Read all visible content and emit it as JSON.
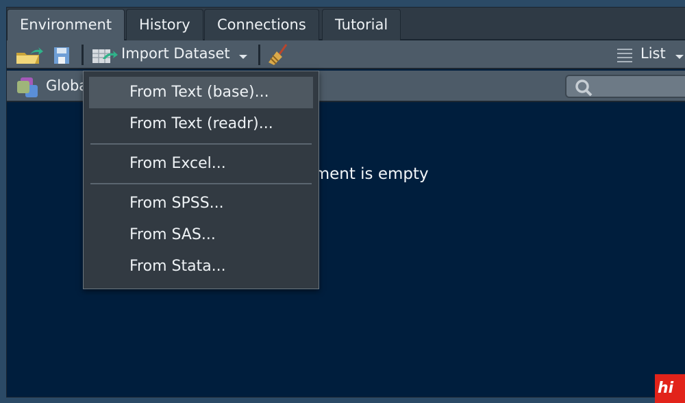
{
  "tabs": [
    {
      "label": "Environment",
      "active": true
    },
    {
      "label": "History"
    },
    {
      "label": "Connections"
    },
    {
      "label": "Tutorial"
    }
  ],
  "toolbar": {
    "import_label": "Import Dataset",
    "view_label": "List"
  },
  "environment_selector": "Global Environment",
  "search": {
    "placeholder": ""
  },
  "empty_message": "Environment is empty",
  "import_menu": {
    "items": [
      "From Text (base)...",
      "From Text (readr)...",
      "From Excel...",
      "From SPSS...",
      "From SAS...",
      "From Stata..."
    ],
    "highlighted": "From Text (base)..."
  },
  "watermark": "hi"
}
